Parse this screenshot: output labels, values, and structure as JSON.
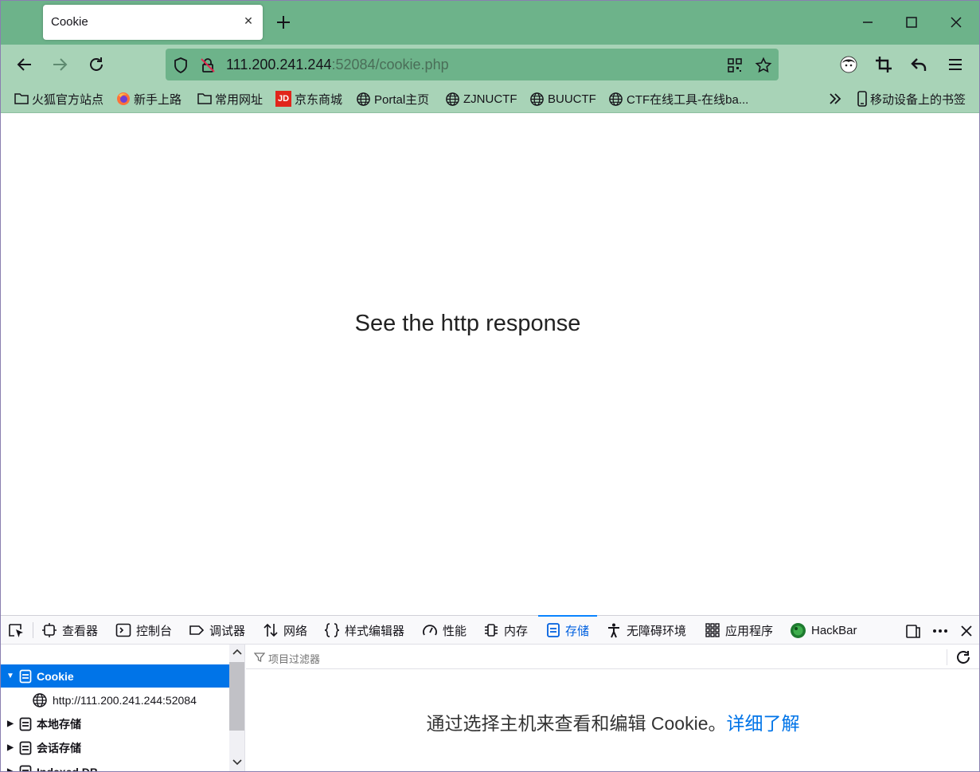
{
  "tab": {
    "title": "Cookie"
  },
  "address": {
    "host": "111.200.241.244",
    "path": ":52084/cookie.php"
  },
  "bookmarks": {
    "items": [
      {
        "label": "火狐官方站点",
        "icon": "folder-icon"
      },
      {
        "label": "新手上路",
        "icon": "firefox-icon"
      },
      {
        "label": "常用网址",
        "icon": "folder-icon"
      },
      {
        "label": "京东商城",
        "icon": "jd-icon"
      },
      {
        "label": "Portal主页",
        "icon": "globe-icon"
      },
      {
        "label": "ZJNUCTF",
        "icon": "globe-icon"
      },
      {
        "label": "BUUCTF",
        "icon": "globe-icon"
      },
      {
        "label": "CTF在线工具-在线ba...",
        "icon": "globe-icon"
      }
    ],
    "mobile": "移动设备上的书签",
    "jd_logo": "JD"
  },
  "page": {
    "message": "See the http response"
  },
  "devtools": {
    "tabs": [
      {
        "label": "查看器",
        "icon": "inspector-icon"
      },
      {
        "label": "控制台",
        "icon": "console-icon"
      },
      {
        "label": "调试器",
        "icon": "debugger-icon"
      },
      {
        "label": "网络",
        "icon": "network-icon"
      },
      {
        "label": "样式编辑器",
        "icon": "style-editor-icon"
      },
      {
        "label": "性能",
        "icon": "performance-icon"
      },
      {
        "label": "内存",
        "icon": "memory-icon"
      },
      {
        "label": "存储",
        "icon": "storage-icon"
      },
      {
        "label": "无障碍环境",
        "icon": "accessibility-icon"
      },
      {
        "label": "应用程序",
        "icon": "application-icon"
      },
      {
        "label": "HackBar",
        "icon": "hackbar-icon"
      }
    ],
    "active_tab": "存储",
    "tree": {
      "cookie": "Cookie",
      "host": "http://111.200.241.244:52084",
      "local_storage": "本地存储",
      "session_storage": "会话存储",
      "indexed_db": "Indexed DB"
    },
    "filter_placeholder": "项目过滤器",
    "notice": "通过选择主机来查看和编辑 Cookie。",
    "learn_more": "详细了解"
  },
  "colors": {
    "tabstrip": "#6db38a",
    "toolbar": "#a8d3b7",
    "accent": "#0074e8"
  }
}
